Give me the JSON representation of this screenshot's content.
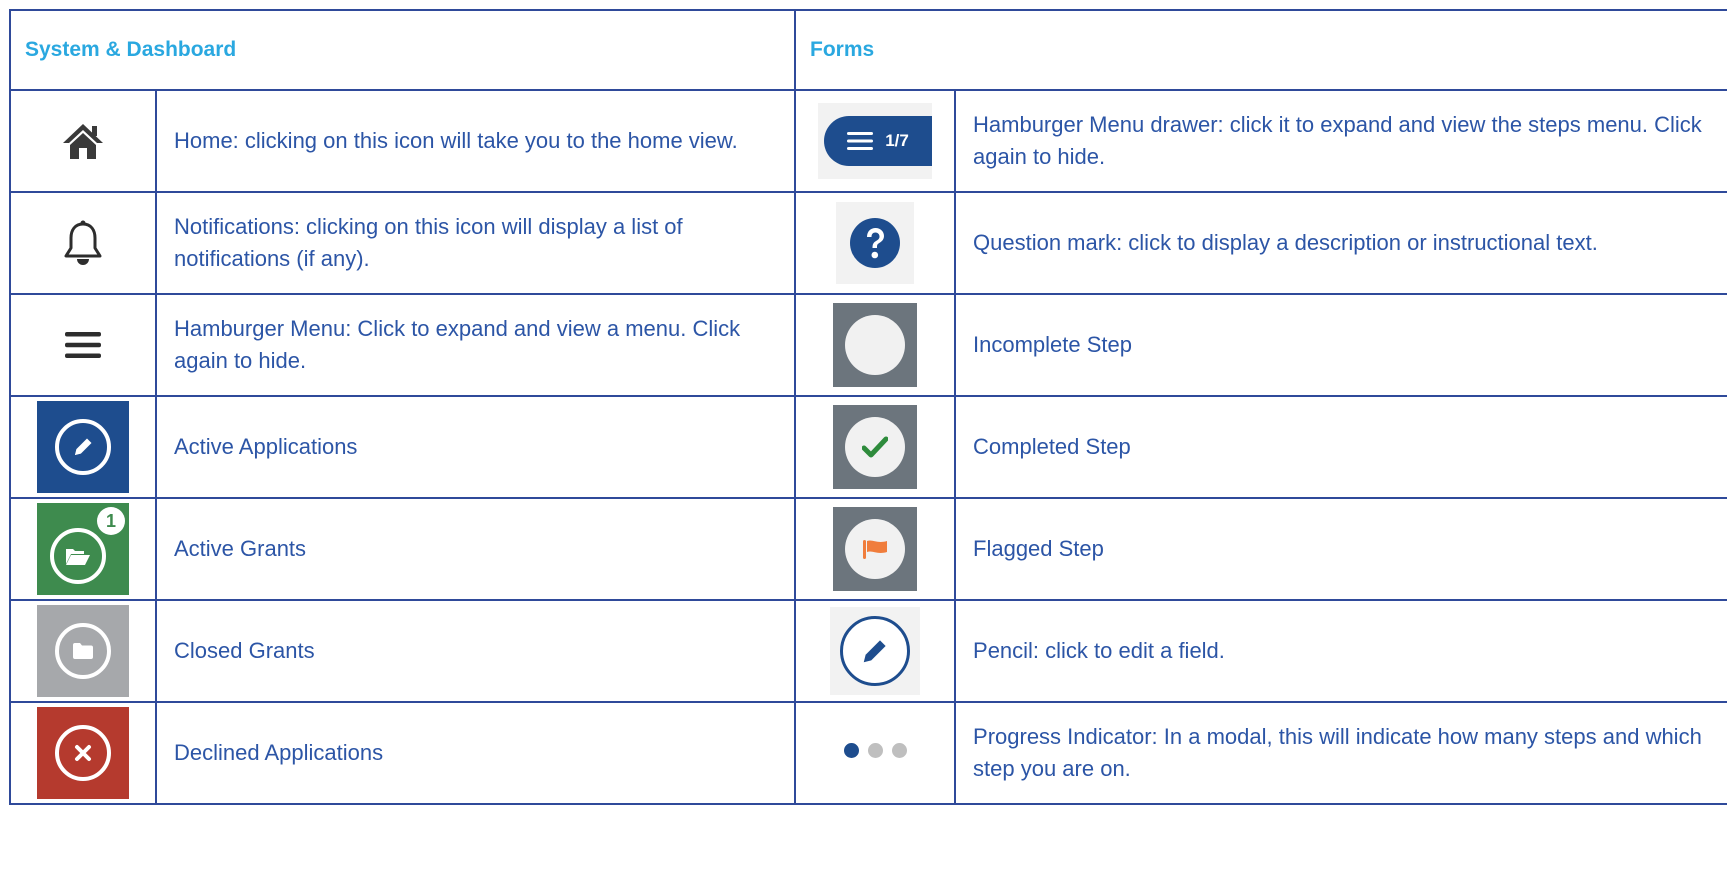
{
  "headers": {
    "left": "System & Dashboard",
    "right": "Forms"
  },
  "left_rows": [
    {
      "icon": "home-icon",
      "text": "Home: clicking on this icon will take you to the home view."
    },
    {
      "icon": "bell-icon",
      "text": "Notifications: clicking on this icon will display a list of notifications (if any)."
    },
    {
      "icon": "hamburger-menu-icon",
      "text": "Hamburger Menu: Click to expand and view a menu. Click again to hide."
    },
    {
      "icon": "pencil-circle-icon",
      "text": "Active Applications",
      "color": "#1E4D8E"
    },
    {
      "icon": "open-folder-icon",
      "text": "Active Grants",
      "color": "#3E8B4E",
      "badge": "1"
    },
    {
      "icon": "closed-folder-icon",
      "text": "Closed Grants",
      "color": "#A6A8AB"
    },
    {
      "icon": "x-circle-icon",
      "text": "Declined Applications",
      "color": "#B53A2E"
    }
  ],
  "right_rows": [
    {
      "icon": "hamburger-drawer-icon",
      "text": "Hamburger Menu drawer: click it to expand and view the steps menu. Click again to hide.",
      "counter": "1/7",
      "color": "#1E4D8E"
    },
    {
      "icon": "question-mark-icon",
      "text": "Question mark: click to display a description or instructional text.",
      "color": "#1E4D8E"
    },
    {
      "icon": "empty-circle-icon",
      "text": "Incomplete Step",
      "color": "#6C757D"
    },
    {
      "icon": "check-circle-icon",
      "text": "Completed Step",
      "color": "#6C757D",
      "accent": "#2E8B3C"
    },
    {
      "icon": "flag-circle-icon",
      "text": "Flagged Step",
      "color": "#6C757D",
      "accent": "#F07D3C"
    },
    {
      "icon": "pencil-edit-icon",
      "text": "Pencil: click to edit a field.",
      "color": "#1E4D8E"
    },
    {
      "icon": "progress-dots-icon",
      "text": "Progress Indicator: In a modal, this will indicate how many steps and which step you are on.",
      "color": "#1E4D8E",
      "inactive": "#BFBFBF"
    }
  ],
  "colors": {
    "border": "#2F4A9A",
    "header_text": "#2AA8E0",
    "body_text": "#2C55A6"
  }
}
